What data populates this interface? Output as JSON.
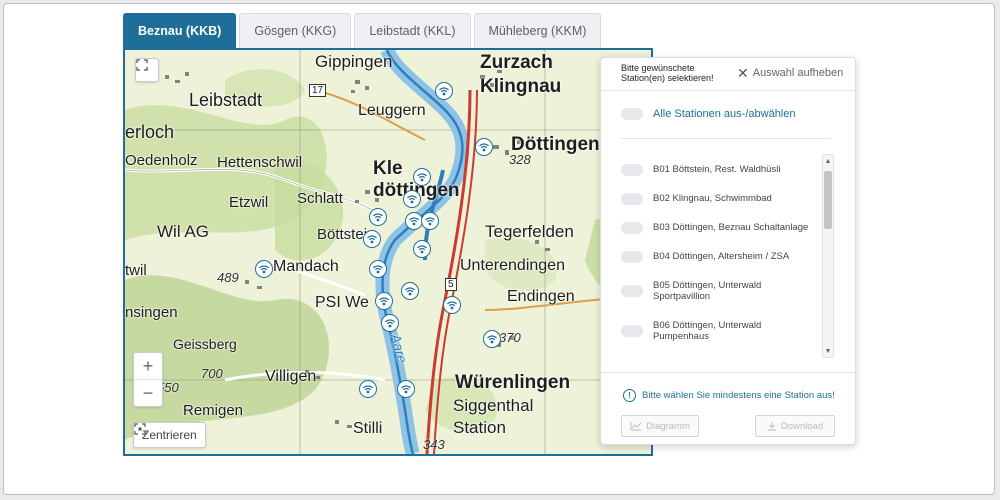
{
  "tabs": [
    {
      "label": "Beznau (KKB)",
      "active": true
    },
    {
      "label": "Gösgen (KKG)",
      "active": false
    },
    {
      "label": "Leibstadt (KKL)",
      "active": false
    },
    {
      "label": "Mühleberg (KKM)",
      "active": false
    }
  ],
  "map": {
    "places": [
      "Gippingen",
      "Zurzach",
      "Leibstadt",
      "Klingnau",
      "Leuggern",
      "erloch",
      "Döttingen",
      "Oedenholz",
      "Hettenschwil",
      "Kle",
      "döttingen",
      "Schlatt",
      "Etzwil",
      "Tegerfelden",
      "Wil AG",
      "Böttstei",
      "Unterendingen",
      "twil",
      "Mandach",
      "PSI We",
      "Endingen",
      "nsingen",
      "Geissberg",
      "Aare",
      "Villigen",
      "Würenlingen",
      "Remigen",
      "Siggenthal",
      "Station",
      "Stilli"
    ],
    "heights": [
      "328",
      "489",
      "370",
      "700",
      "550",
      "343"
    ],
    "road_numbers": [
      "17",
      "5"
    ],
    "center_label": "Zentrieren",
    "zoom_in": "+",
    "zoom_out": "−"
  },
  "panel": {
    "prompt": "Bitte gewünschete Station(en) selektieren!",
    "clear_label": "Auswahl aufheben",
    "select_all": "Alle Stationen aus-/abwählen",
    "stations": [
      "B01 Böttstein, Rest. Waldhüsli",
      "B02 Klingnau, Schwimmbad",
      "B03 Döttingen, Beznau Schaltanlage",
      "B04 Döttingen, Altersheim / ZSA",
      "B05 Döttingen, Unterwald Sportpavillion",
      "B06 Döttingen, Unterwald Pumpenhaus"
    ],
    "hint": "Bitte wählen Sie mindestens eine Station aus!",
    "diagram_label": "Diagramm",
    "download_label": "Download"
  },
  "colors": {
    "accent": "#1f6e9a",
    "aare": "#2f7fbf",
    "station_icon": "#1f6e9a",
    "road": "#cc3b2f"
  }
}
